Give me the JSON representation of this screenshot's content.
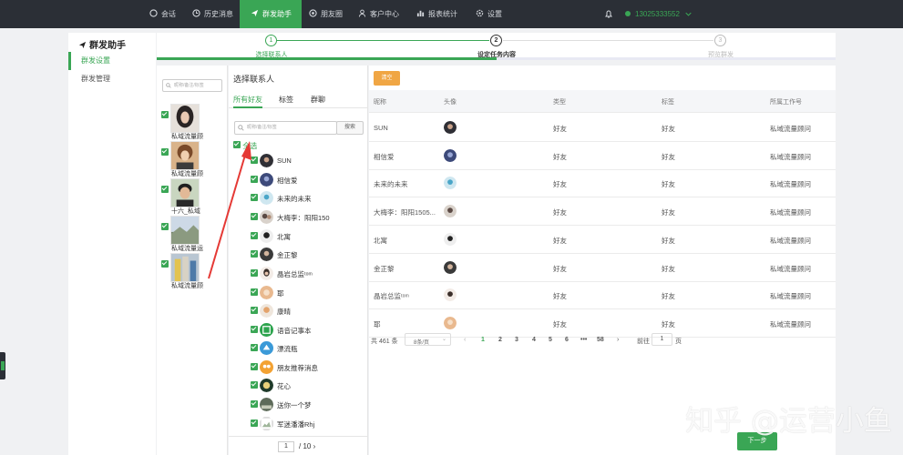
{
  "nav": {
    "items": [
      {
        "label": "会话",
        "icon": "chat-icon"
      },
      {
        "label": "历史消息",
        "icon": "clock-icon"
      },
      {
        "label": "群发助手",
        "icon": "send-icon"
      },
      {
        "label": "朋友圈",
        "icon": "moments-icon"
      },
      {
        "label": "客户中心",
        "icon": "user-icon"
      },
      {
        "label": "报表统计",
        "icon": "chart-icon"
      },
      {
        "label": "设置",
        "icon": "gear-icon"
      }
    ],
    "active_index": 2,
    "user": "13025333552"
  },
  "sidebar": {
    "title": "群发助手",
    "items": [
      {
        "label": "群发设置"
      },
      {
        "label": "群发管理"
      }
    ]
  },
  "steps": [
    {
      "num": "1",
      "label": "选择联系人",
      "state": "done"
    },
    {
      "num": "2",
      "label": "设定任务内容",
      "state": "current"
    },
    {
      "num": "3",
      "label": "预览群发",
      "state": "todo"
    }
  ],
  "selected_panel": {
    "search_placeholder": "昵称/备注/标签",
    "items": [
      {
        "name": "私域流量顾"
      },
      {
        "name": "私域流量顾"
      },
      {
        "name": "十六_私域"
      },
      {
        "name": "私域流量运"
      },
      {
        "name": "私域流量顾"
      }
    ]
  },
  "contacts_panel": {
    "title": "选择联系人",
    "tabs": [
      "所有好友",
      "标签",
      "群聊"
    ],
    "search_placeholder": "昵称/备注/标签",
    "search_button": "搜索",
    "select_all": "全选",
    "contacts": [
      {
        "name": "SUN"
      },
      {
        "name": "相信爱"
      },
      {
        "name": "未来的未来"
      },
      {
        "name": "大梅李：阳阳150"
      },
      {
        "name": "北寓"
      },
      {
        "name": "金正黎"
      },
      {
        "name": "晶岩总监ᵗᵒᵐ"
      },
      {
        "name": "耶"
      },
      {
        "name": "康晴"
      },
      {
        "name": "语音记事本"
      },
      {
        "name": "漂流瓶"
      },
      {
        "name": "朋友推荐消息"
      },
      {
        "name": "花心"
      },
      {
        "name": "送你一个梦"
      },
      {
        "name": "军迷潘潘Rhj"
      }
    ],
    "page_current": "1",
    "page_total": "/ 10"
  },
  "table_panel": {
    "clear_button": "清空",
    "columns": [
      "昵称",
      "头像",
      "类型",
      "标签",
      "所属工作号"
    ],
    "rows": [
      {
        "nickname": "SUN",
        "type": "好友",
        "tag": "好友",
        "account": "私域流量顾问"
      },
      {
        "nickname": "相信爱",
        "type": "好友",
        "tag": "好友",
        "account": "私域流量顾问"
      },
      {
        "nickname": "未来的未来",
        "type": "好友",
        "tag": "好友",
        "account": "私域流量顾问"
      },
      {
        "nickname": "大梅李：阳阳1505...",
        "type": "好友",
        "tag": "好友",
        "account": "私域流量顾问"
      },
      {
        "nickname": "北寓",
        "type": "好友",
        "tag": "好友",
        "account": "私域流量顾问"
      },
      {
        "nickname": "金正黎",
        "type": "好友",
        "tag": "好友",
        "account": "私域流量顾问"
      },
      {
        "nickname": "晶岩总监ᵗᵒᵐ",
        "type": "好友",
        "tag": "好友",
        "account": "私域流量顾问"
      },
      {
        "nickname": "耶",
        "type": "好友",
        "tag": "好友",
        "account": "私域流量顾问"
      }
    ],
    "pager": {
      "total": "共 461 条",
      "page_size": "8条/页",
      "pages": [
        "1",
        "2",
        "3",
        "4",
        "5",
        "6",
        "•••",
        "58"
      ],
      "goto_label": "前往",
      "goto_value": "1",
      "page_unit": "页"
    }
  },
  "next_button": "下一步",
  "watermark": "知乎 @运营小鱼",
  "colors": {
    "accent": "#3aa655",
    "orange": "#f0a644",
    "nav_bg": "#2b2f36",
    "arrow": "#e53935"
  }
}
